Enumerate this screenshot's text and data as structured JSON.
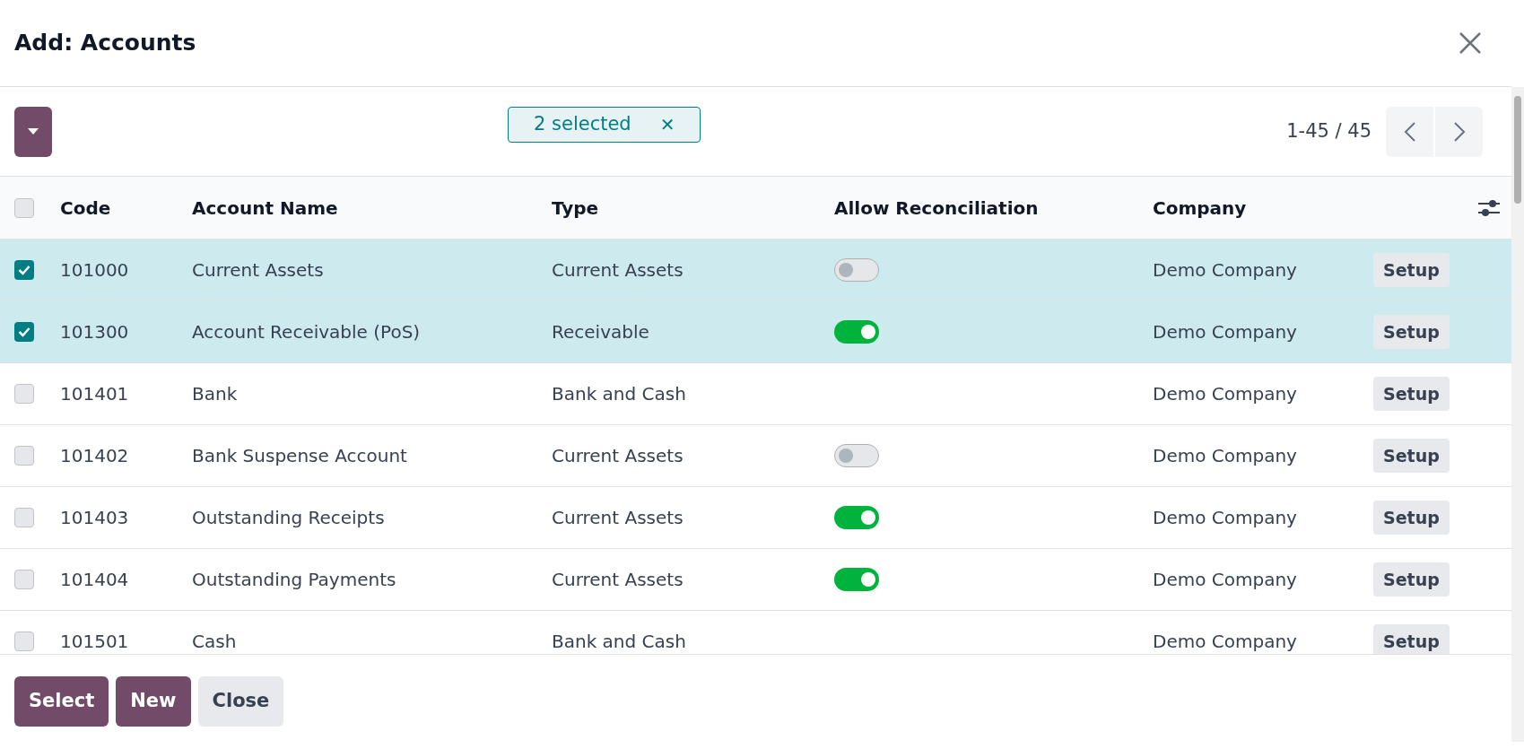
{
  "dialog": {
    "title": "Add: Accounts"
  },
  "toolbar": {
    "selection_badge": "2 selected",
    "badge_clear": "✕",
    "pager": "1-45 / 45"
  },
  "table": {
    "select_all": false,
    "columns": [
      "Code",
      "Account Name",
      "Type",
      "Allow Reconciliation",
      "Company"
    ],
    "rows": [
      {
        "selected": true,
        "code": "101000",
        "name": "Current Assets",
        "type": "Current Assets",
        "allow_reconciliation": false,
        "company": "Demo Company",
        "action": "Setup"
      },
      {
        "selected": true,
        "code": "101300",
        "name": "Account Receivable (PoS)",
        "type": "Receivable",
        "allow_reconciliation": true,
        "company": "Demo Company",
        "action": "Setup"
      },
      {
        "selected": false,
        "code": "101401",
        "name": "Bank",
        "type": "Bank and Cash",
        "company": "Demo Company",
        "action": "Setup"
      },
      {
        "selected": false,
        "code": "101402",
        "name": "Bank Suspense Account",
        "type": "Current Assets",
        "allow_reconciliation": false,
        "company": "Demo Company",
        "action": "Setup"
      },
      {
        "selected": false,
        "code": "101403",
        "name": "Outstanding Receipts",
        "type": "Current Assets",
        "allow_reconciliation": true,
        "company": "Demo Company",
        "action": "Setup"
      },
      {
        "selected": false,
        "code": "101404",
        "name": "Outstanding Payments",
        "type": "Current Assets",
        "allow_reconciliation": true,
        "company": "Demo Company",
        "action": "Setup"
      },
      {
        "selected": false,
        "code": "101501",
        "name": "Cash",
        "type": "Bank and Cash",
        "company": "Demo Company",
        "action": "Setup"
      }
    ]
  },
  "footer": {
    "buttons": [
      "Select",
      "New",
      "Close"
    ]
  }
}
